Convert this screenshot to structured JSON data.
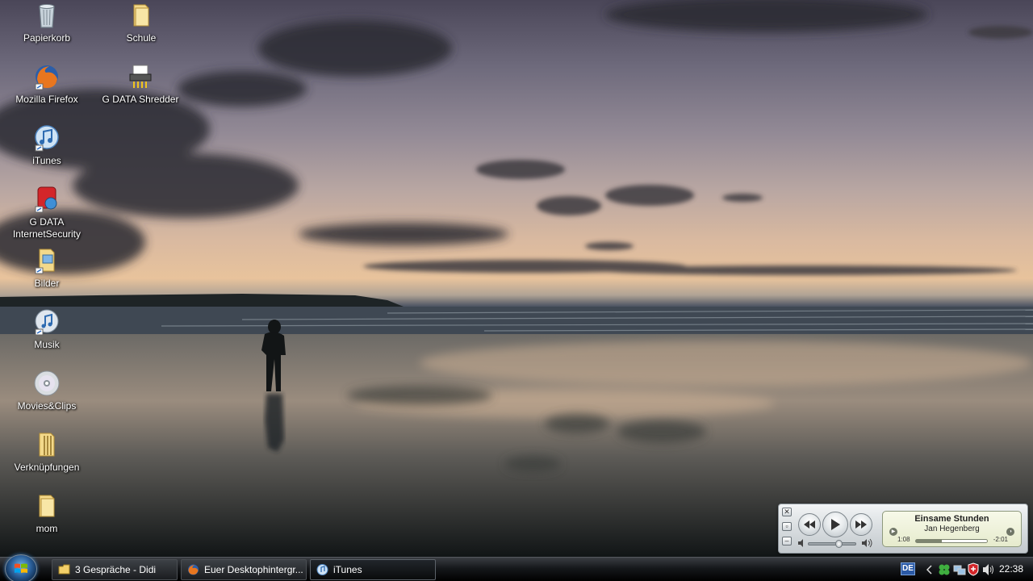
{
  "desktop": {
    "icons": [
      {
        "label": "Papierkorb",
        "icon": "recycle-bin-icon"
      },
      {
        "label": "Schule",
        "icon": "folder-icon"
      },
      {
        "label": "Mozilla Firefox",
        "icon": "firefox-icon"
      },
      {
        "label": "G DATA Shredder",
        "icon": "shredder-icon"
      },
      {
        "label": "iTunes",
        "icon": "itunes-icon"
      },
      {
        "label": "G DATA\nInternetSecurity",
        "icon": "gdata-icon"
      },
      {
        "label": "Bilder",
        "icon": "pictures-shortcut-icon"
      },
      {
        "label": "Musik",
        "icon": "music-shortcut-icon"
      },
      {
        "label": "Movies&Clips",
        "icon": "disc-icon"
      },
      {
        "label": "Verknüpfungen",
        "icon": "zip-folder-icon"
      },
      {
        "label": "mom",
        "icon": "folder-icon"
      }
    ]
  },
  "mini_player": {
    "song": "Einsame Stunden",
    "artist": "Jan Hegenberg",
    "elapsed": "1:08",
    "remaining": "-2:01",
    "progress_fraction": 0.36,
    "volume_fraction": 0.65,
    "controls": [
      "previous-icon",
      "play-icon",
      "next-icon"
    ]
  },
  "taskbar": {
    "tasks": [
      {
        "label": "3 Gespräche - Didi",
        "icon": "chat-icon"
      },
      {
        "label": "Euer Desktophintergr...",
        "icon": "firefox-icon"
      },
      {
        "label": "iTunes",
        "icon": "itunes-icon"
      }
    ],
    "language": "DE",
    "clock": "22:38"
  },
  "colors": {
    "taskbar": "#000000",
    "accent": "#2b5aa6",
    "lcd": "#e6ebcd"
  }
}
